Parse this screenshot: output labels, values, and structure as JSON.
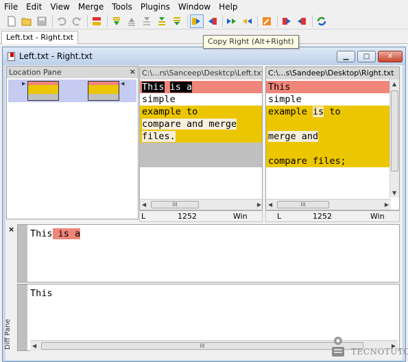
{
  "menu": [
    "File",
    "Edit",
    "View",
    "Merge",
    "Tools",
    "Plugins",
    "Window",
    "Help"
  ],
  "toolbar": {
    "tooltip": "Copy Right (Alt+Right)"
  },
  "doc_tab": "Left.txt - Right.txt",
  "window": {
    "title": "Left.txt - Right.txt",
    "minimize": "▁",
    "maximize": "□",
    "close": "✕"
  },
  "location_pane": {
    "title": "Location Pane",
    "close": "×"
  },
  "left_pane": {
    "path": "C:\\...rs\\Sanceep\\Desktcp\\Left.txt",
    "lines": [
      "This is a",
      "simple",
      "example to",
      "compare and merge",
      "files.",
      "",
      ""
    ]
  },
  "right_pane": {
    "path": "C:\\...s\\Sandeep\\Desktop\\Right.txt",
    "lines": [
      "This",
      "simple",
      "example is to",
      "",
      "merge and",
      "",
      "compare files;"
    ]
  },
  "status_left": {
    "eol": "L",
    "codepage": "1252",
    "platform": "Win"
  },
  "status_right": {
    "eol": "L",
    "codepage": "1252",
    "platform": "Win"
  },
  "diff_pane": {
    "title": "Diff Pane",
    "close": "×",
    "top_line_a": "This",
    "top_line_b": " is a",
    "bottom_line": "This"
  },
  "scroll_thumb": "III",
  "watermark": "TECNOTUTO",
  "colors": {
    "diff_red": "#f0857a",
    "diff_yellow": "#ecc600",
    "gap_gray": "#c0c0c0"
  }
}
